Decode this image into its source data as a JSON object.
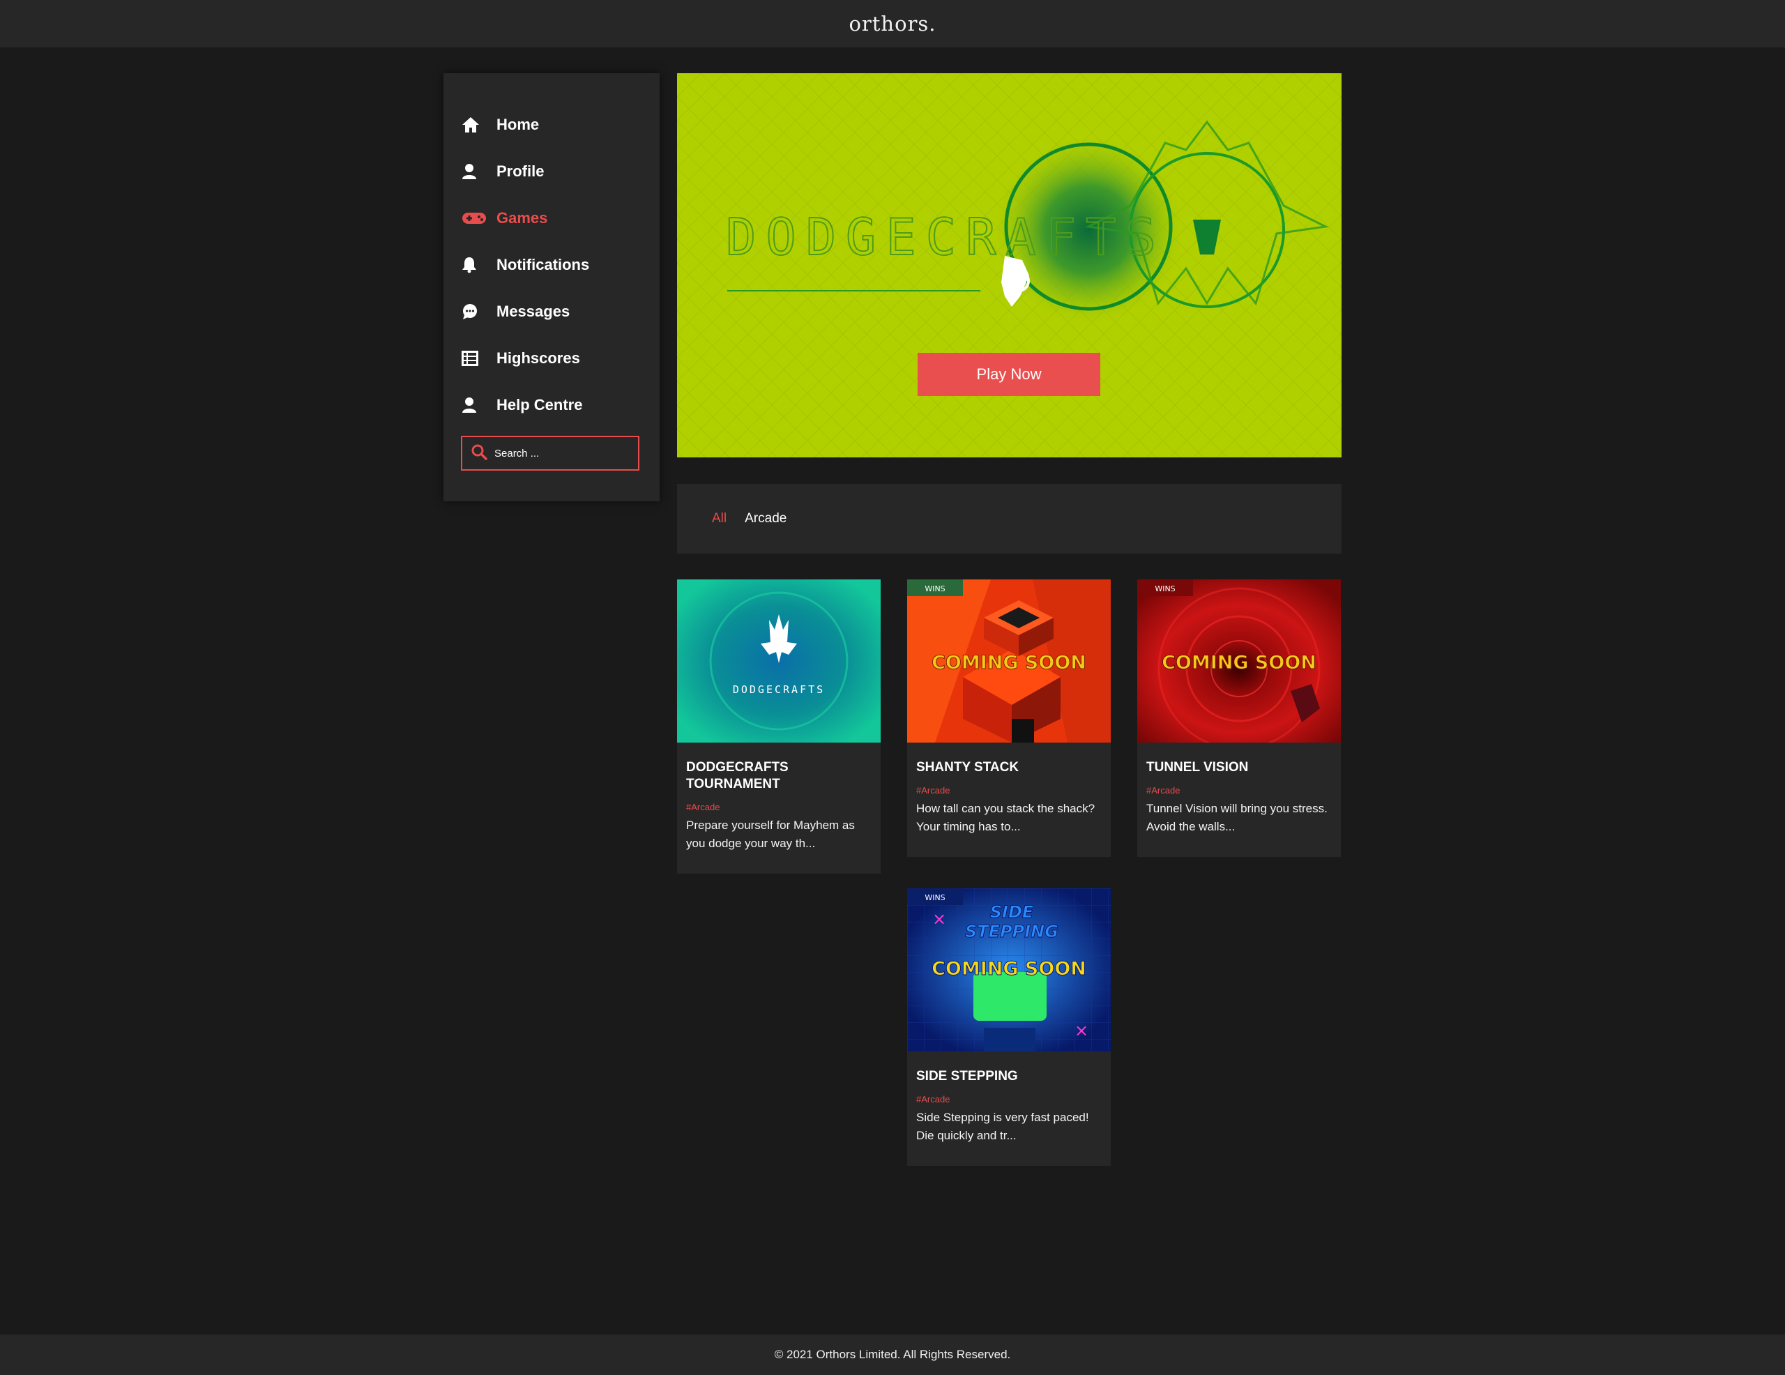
{
  "brand": "orthors.",
  "sidebar": {
    "items": [
      {
        "label": "Home",
        "icon": "home-icon"
      },
      {
        "label": "Profile",
        "icon": "user-icon"
      },
      {
        "label": "Games",
        "icon": "gamepad-icon",
        "active": true
      },
      {
        "label": "Notifications",
        "icon": "bell-icon"
      },
      {
        "label": "Messages",
        "icon": "chat-icon"
      },
      {
        "label": "Highscores",
        "icon": "table-icon"
      },
      {
        "label": "Help Centre",
        "icon": "user-icon"
      }
    ],
    "search_placeholder": "Search ..."
  },
  "hero": {
    "logo_text": "DODGECRAFTS",
    "cta_label": "Play Now"
  },
  "filters": [
    {
      "label": "All",
      "active": true
    },
    {
      "label": "Arcade",
      "active": false
    }
  ],
  "games": [
    {
      "title": "DODGECRAFTS TOURNAMENT",
      "tag": "#Arcade",
      "description": "Prepare yourself for Mayhem as you dodge your way th...",
      "thumb_text": "DODGECRAFTS"
    },
    {
      "title": "SHANTY STACK",
      "tag": "#Arcade",
      "description": "How tall can you stack the shack? Your timing has to...",
      "thumb_text": "COMING SOON",
      "badge": "WINS"
    },
    {
      "title": "TUNNEL VISION",
      "tag": "#Arcade",
      "description": "Tunnel Vision will bring you stress. Avoid the walls...",
      "thumb_text": "COMING SOON",
      "badge": "WINS"
    },
    {
      "title": "SIDE STEPPING",
      "tag": "#Arcade",
      "description": "Side Stepping is very fast paced! Die quickly and tr...",
      "thumb_text": "COMING SOON",
      "thumb_title_1": "SIDE",
      "thumb_title_2": "STEPPING",
      "badge": "WINS"
    }
  ],
  "footer": "© 2021 Orthors Limited. All Rights Reserved.",
  "colors": {
    "accent": "#e84c4c",
    "hero_bg": "#b1d000",
    "panel": "#272727",
    "page_bg": "#1a1a1a"
  }
}
